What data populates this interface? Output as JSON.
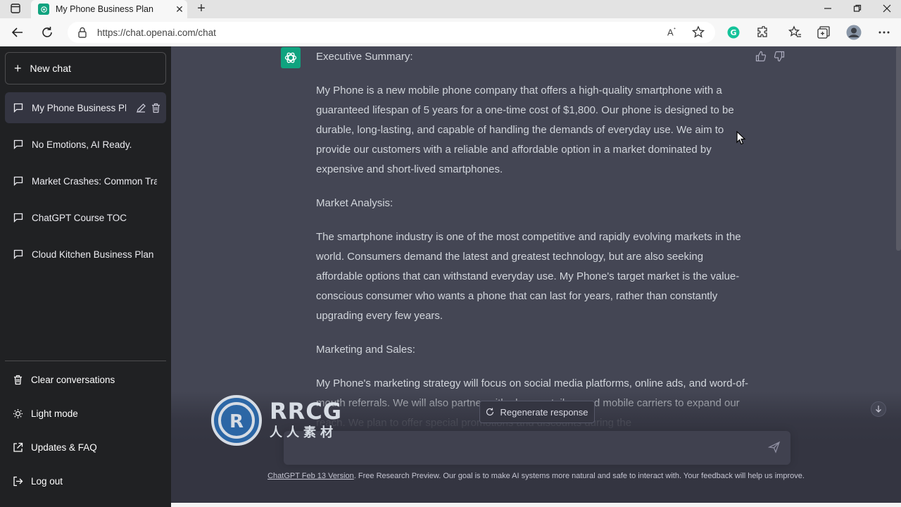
{
  "browser": {
    "tab_title": "My Phone Business Plan",
    "url": "https://chat.openai.com/chat"
  },
  "sidebar": {
    "new_chat_label": "New chat",
    "conversations": [
      {
        "label": "My Phone Business Pla",
        "active": true
      },
      {
        "label": "No Emotions, AI Ready.",
        "active": false
      },
      {
        "label": "Market Crashes: Common Trai",
        "active": false
      },
      {
        "label": "ChatGPT Course TOC",
        "active": false
      },
      {
        "label": "Cloud Kitchen Business Plan",
        "active": false
      }
    ],
    "clear_label": "Clear conversations",
    "light_mode_label": "Light mode",
    "updates_label": "Updates & FAQ",
    "logout_label": "Log out"
  },
  "message": {
    "paragraphs": [
      "Executive Summary:",
      "My Phone is a new mobile phone company that offers a high-quality smartphone with a guaranteed lifespan of 5 years for a one-time cost of $1,800. Our phone is designed to be durable, long-lasting, and capable of handling the demands of everyday use. We aim to provide our customers with a reliable and affordable option in a market dominated by expensive and short-lived smartphones.",
      "Market Analysis:",
      "The smartphone industry is one of the most competitive and rapidly evolving markets in the world. Consumers demand the latest and greatest technology, but are also seeking affordable options that can withstand everyday use. My Phone's target market is the value-conscious consumer who wants a phone that can last for years, rather than constantly upgrading every few years.",
      "Marketing and Sales:",
      "My Phone's marketing strategy will focus on social media platforms, online ads, and word-of-mouth referrals. We will also partner with phone retailers and mobile carriers to expand our reach. We plan to offer special promotions and discounts during the"
    ]
  },
  "composer": {
    "regenerate_label": "Regenerate response",
    "input_value": ""
  },
  "footer": {
    "version_link": "ChatGPT Feb 13 Version",
    "text": ". Free Research Preview. Our goal is to make AI systems more natural and safe to interact with. Your feedback will help us improve."
  },
  "watermark": {
    "big": "RRCG",
    "small": "人人素材"
  }
}
